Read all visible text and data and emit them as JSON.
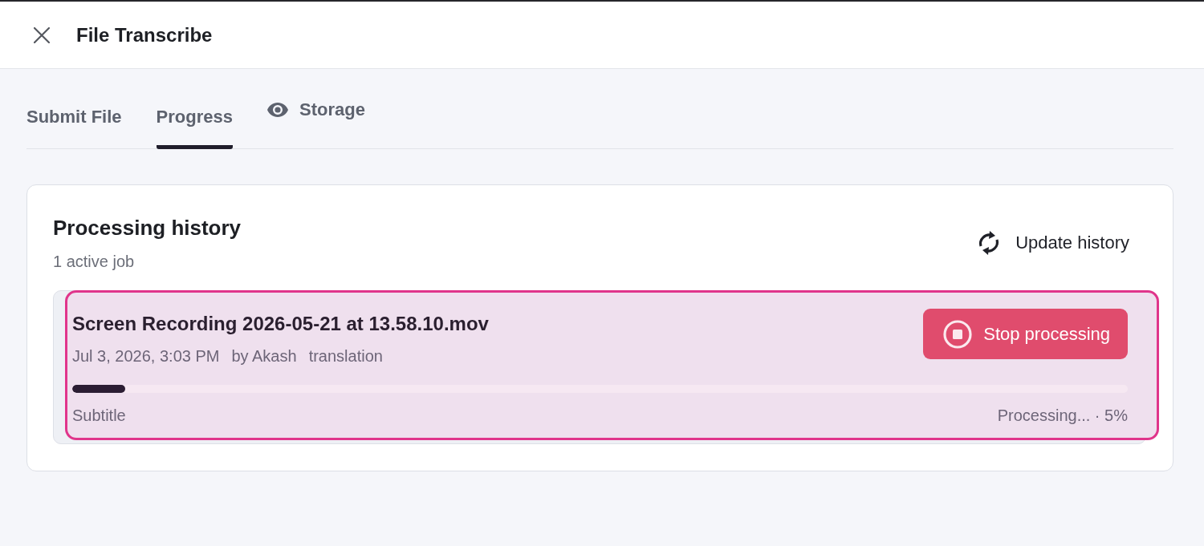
{
  "window": {
    "title": "File Transcribe"
  },
  "tabs": [
    {
      "label": "Submit File",
      "selected": false,
      "kind": "text"
    },
    {
      "label": "Progress",
      "selected": true,
      "kind": "text"
    },
    {
      "label": "Storage",
      "selected": false,
      "kind": "eye"
    }
  ],
  "history": {
    "title": "Processing history",
    "subtitle": "1 active job",
    "update_button": "Update history",
    "jobs": [
      {
        "name": "Screen Recording 2026-05-21 at 13.58.10.mov",
        "date": "Jul 3, 2026, 3:03 PM",
        "author": "by Akash",
        "task": "translation",
        "highlighted": true,
        "level": 0.05,
        "type": "Subtitle",
        "status": "Processing... · 5%",
        "stop_button": "Stop processing"
      }
    ]
  }
}
